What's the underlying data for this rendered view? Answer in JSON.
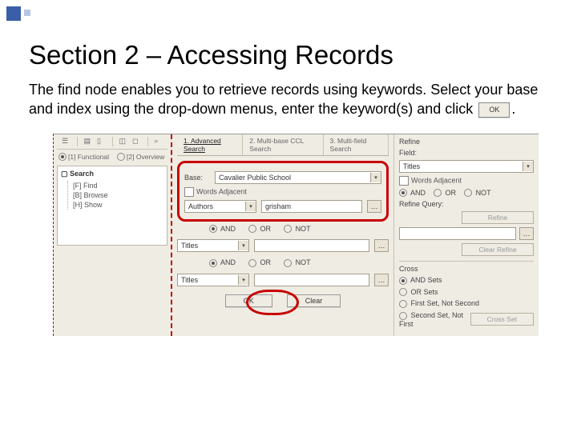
{
  "slide": {
    "title": "Section 2 – Accessing Records",
    "body_part1": "The find node enables you to retrieve records using keywords. Select your base and index using the drop-down menus, enter the keyword(s) and click",
    "body_part2": ".",
    "inline_ok": "OK"
  },
  "toolbar": {
    "icons": [
      "menu",
      "bullets",
      "doc",
      "book",
      "cal",
      "flag",
      "search"
    ]
  },
  "left": {
    "view1": "[1] Functional",
    "view2": "[2] Overview",
    "tree_root": "Search",
    "tree_items": [
      "[F] Find",
      "[B] Browse",
      "[H] Show"
    ]
  },
  "mid": {
    "tabs": [
      "1. Advanced Search",
      "2. Multi-base CCL Search",
      "3. Multi-field Search"
    ],
    "base_label": "Base:",
    "base_value": "Cavalier Public School",
    "words_adj": "Words Adjacent",
    "authors_label": "Authors",
    "search_value": "grisham",
    "titles_label": "Titles",
    "logic": {
      "and": "AND",
      "or": "OR",
      "not": "NOT"
    },
    "ok": "OK",
    "clear": "Clear"
  },
  "right": {
    "refine_title": "Refine",
    "field_label": "Field:",
    "field_value": "Titles",
    "words_adj": "Words Adjacent",
    "logic": {
      "and": "AND",
      "or": "OR",
      "not": "NOT"
    },
    "refine_query": "Refine Query:",
    "refine_btn": "Refine",
    "clear_refine_btn": "Clear Refine",
    "cross_title": "Cross",
    "and_sets": "AND Sets",
    "or_sets": "OR Sets",
    "first_not_second": "First Set, Not Second",
    "second_not_first": "Second Set, Not First",
    "cross_btn": "Cross Set"
  }
}
